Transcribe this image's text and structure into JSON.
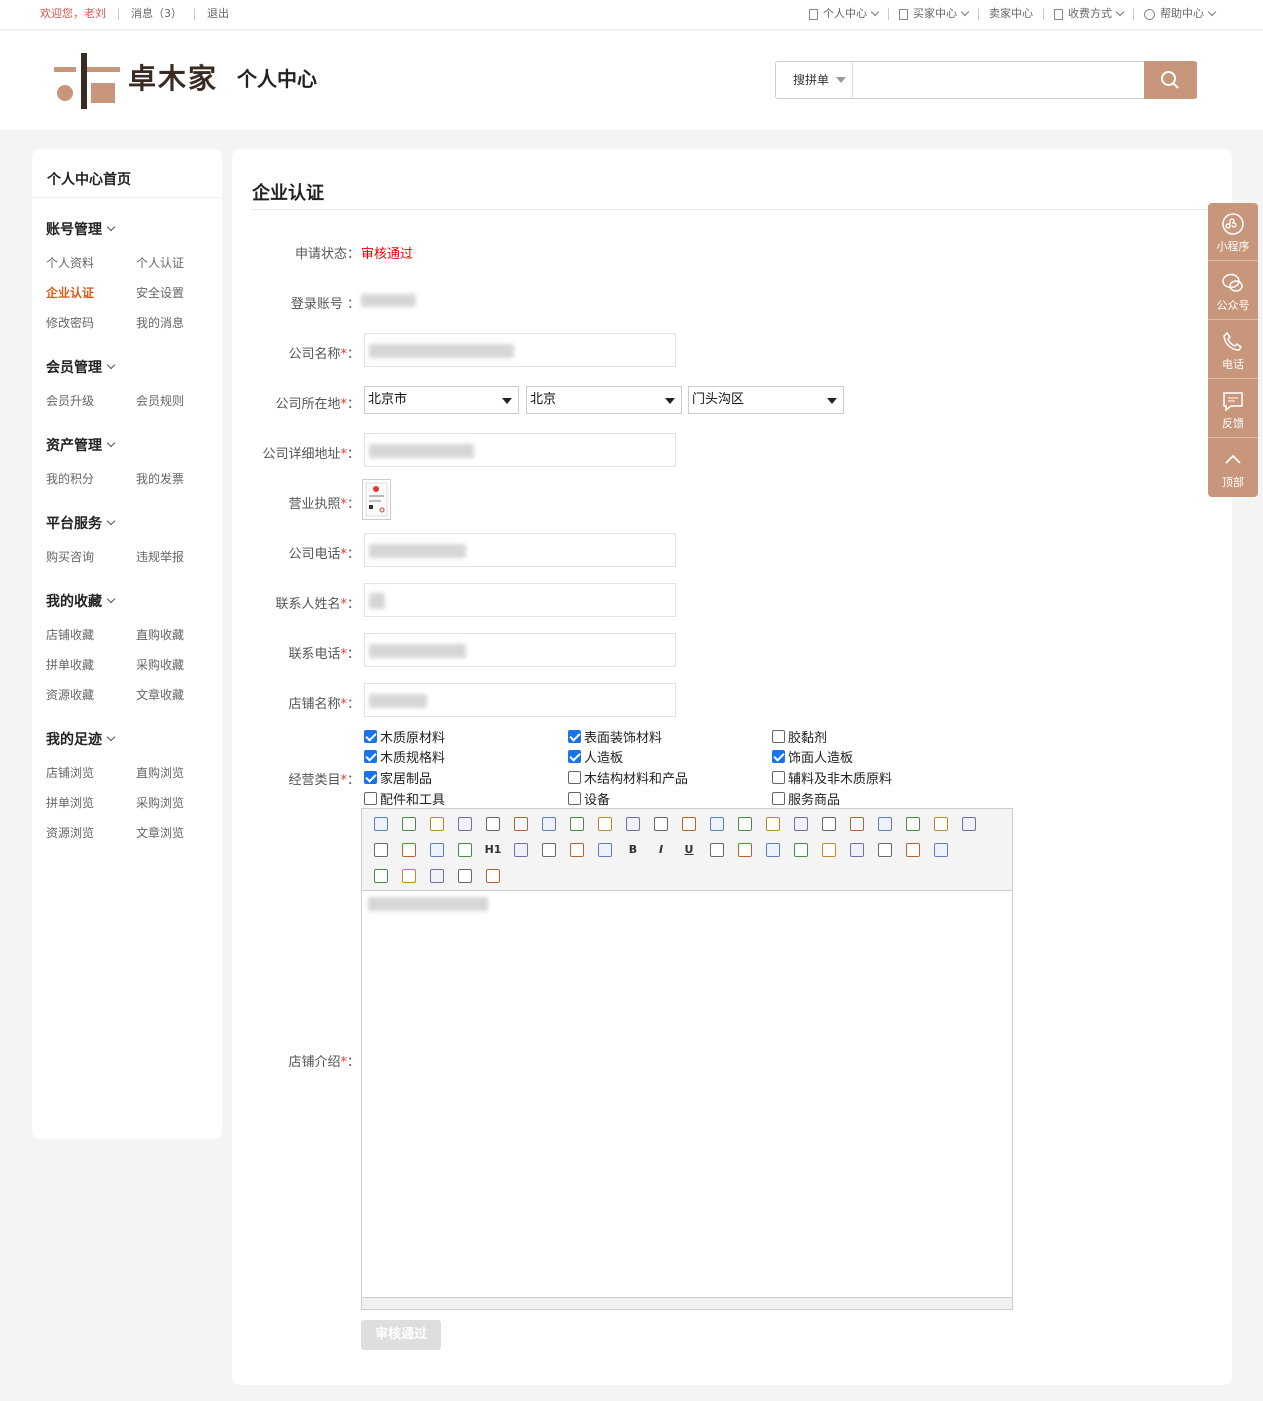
{
  "topbar": {
    "welcome": "欢迎您，老刘",
    "messages": "消息（3）",
    "logout": "退出",
    "right_items": [
      {
        "label": "个人中心",
        "icon": "doc-icon",
        "dropdown": true
      },
      {
        "label": "买家中心",
        "icon": "doc-icon",
        "dropdown": true
      },
      {
        "label": "卖家中心",
        "icon": "",
        "dropdown": false
      },
      {
        "label": "收费方式",
        "icon": "doc-icon",
        "dropdown": true
      },
      {
        "label": "帮助中心",
        "icon": "headset-icon",
        "dropdown": true
      }
    ]
  },
  "header": {
    "logo_text": "卓木家",
    "logo_sub": "个人中心",
    "search_type": "搜拼单",
    "search_placeholder": "",
    "brand_color": "#c8967a"
  },
  "sidebar": {
    "home": "个人中心首页",
    "groups": [
      {
        "title": "账号管理",
        "links": [
          "个人资料",
          "个人认证",
          "企业认证",
          "安全设置",
          "修改密码",
          "我的消息"
        ]
      },
      {
        "title": "会员管理",
        "links": [
          "会员升级",
          "会员规则"
        ]
      },
      {
        "title": "资产管理",
        "links": [
          "我的积分",
          "我的发票"
        ]
      },
      {
        "title": "平台服务",
        "links": [
          "购买咨询",
          "违规举报"
        ]
      },
      {
        "title": "我的收藏",
        "links": [
          "店铺收藏",
          "直购收藏",
          "拼单收藏",
          "采购收藏",
          "资源收藏",
          "文章收藏"
        ]
      },
      {
        "title": "我的足迹",
        "links": [
          "店铺浏览",
          "直购浏览",
          "拼单浏览",
          "采购浏览",
          "资源浏览",
          "文章浏览"
        ]
      }
    ],
    "active_link": "企业认证",
    "active_color": "#e05a1a"
  },
  "main": {
    "title": "企业认证",
    "labels": {
      "status": "申请状态：",
      "account": "登录账号 ：",
      "company_name": "公司名称",
      "location": "公司所在地",
      "address": "公司详细地址",
      "license": "营业执照",
      "phone": "公司电话",
      "contact_name": "联系人姓名",
      "contact_phone": "联系电话",
      "shop_name": "店铺名称",
      "category": "经营类目",
      "intro": "店铺介绍",
      "required_mark": "*",
      "colon": "："
    },
    "status_value": "审核通过",
    "status_color": "#e00000",
    "location": {
      "province": "北京市",
      "city": "北京",
      "district": "门头沟区"
    },
    "categories": [
      {
        "label": "木质原材料",
        "checked": true
      },
      {
        "label": "表面装饰材料",
        "checked": true
      },
      {
        "label": "胶黏剂",
        "checked": false
      },
      {
        "label": "木质规格料",
        "checked": true
      },
      {
        "label": "人造板",
        "checked": true
      },
      {
        "label": "饰面人造板",
        "checked": true
      },
      {
        "label": "家居制品",
        "checked": true
      },
      {
        "label": "木结构材料和产品",
        "checked": false
      },
      {
        "label": "辅料及非木质原料",
        "checked": false
      },
      {
        "label": "配件和工具",
        "checked": false
      },
      {
        "label": "设备",
        "checked": false
      },
      {
        "label": "服务商品",
        "checked": false
      }
    ],
    "editor_tools": [
      "source-icon",
      "undo-icon",
      "redo-icon",
      "preview-icon",
      "print-icon",
      "template-icon",
      "code-icon",
      "cut-icon",
      "copy-icon",
      "paste-icon",
      "paste-text-icon",
      "paste-word-icon",
      "align-left-icon",
      "align-center-icon",
      "align-right-icon",
      "justify-icon",
      "ordered-list-icon",
      "unordered-list-icon",
      "indent-icon",
      "outdent-icon",
      "subscript-icon",
      "superscript-icon",
      "clear-format-icon",
      "select-all-icon",
      "select-icon",
      "fullscreen-icon",
      "H1",
      "font-family-icon",
      "font-size-icon",
      "font-color-icon",
      "highlight-icon",
      "B",
      "I",
      "U",
      "strike-icon",
      "hr-icon",
      "eraser-icon",
      "insert-image-icon",
      "multi-image-icon",
      "media-icon",
      "table-icon",
      "insert-row-icon",
      "emoticon-icon",
      "image-icon",
      "pagebreak-icon",
      "anchor-icon",
      "link-icon",
      "unlink-icon"
    ],
    "submit_label": "审核通过"
  },
  "floatbar": {
    "items": [
      "小程序",
      "公众号",
      "电话",
      "反馈",
      "顶部"
    ]
  }
}
